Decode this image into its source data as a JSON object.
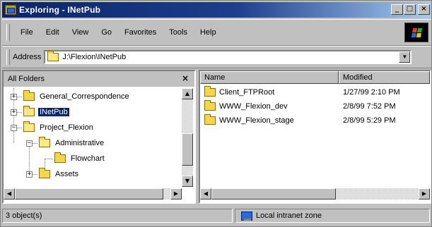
{
  "window": {
    "title": "Exploring - INetPub",
    "controls": [
      "_",
      "□",
      "×"
    ]
  },
  "menu": {
    "items": [
      {
        "label": "File",
        "key": "F"
      },
      {
        "label": "Edit",
        "key": "E"
      },
      {
        "label": "View",
        "key": "V"
      },
      {
        "label": "Go",
        "key": "G"
      },
      {
        "label": "Favorites",
        "key": "a"
      },
      {
        "label": "Tools",
        "key": "T"
      },
      {
        "label": "Help",
        "key": "H"
      }
    ]
  },
  "address": {
    "label": "Address",
    "value": "J:\\Flexion\\INetPub",
    "dropdown_glyph": "▼"
  },
  "folders_pane": {
    "title": "All Folders",
    "close_glyph": "×",
    "tree": [
      {
        "label": "General_Correspondence",
        "expander": "+",
        "selected": false,
        "open": false
      },
      {
        "label": "INetPub",
        "expander": "+",
        "selected": true,
        "open": true
      },
      {
        "label": "Project_Flexion",
        "expander": "−",
        "selected": false,
        "open": true
      },
      {
        "label": "Administrative",
        "expander": "−",
        "selected": false,
        "open": true
      },
      {
        "label": "Flowchart",
        "expander": "",
        "selected": false,
        "open": false
      },
      {
        "label": "Assets",
        "expander": "+",
        "selected": false,
        "open": false
      }
    ]
  },
  "contents_pane": {
    "columns": [
      "Name",
      "Modified"
    ],
    "rows": [
      {
        "name": "Client_FTPRoot",
        "modified": "1/27/99 2:10 PM"
      },
      {
        "name": "WWW_Flexion_dev",
        "modified": "2/8/99 7:52 PM"
      },
      {
        "name": "WWW_Flexion_stage",
        "modified": "2/8/99 5:29 PM"
      }
    ]
  },
  "scroll_glyphs": {
    "up": "▲",
    "down": "▼",
    "left": "◀",
    "right": "▶"
  },
  "status": {
    "objects": "3 object(s)",
    "zone": "Local intranet zone"
  },
  "colors": {
    "title_active": "#0a246a",
    "face": "#c0c0c0",
    "folder": "#f4d64a",
    "selection": "#0a246a"
  }
}
